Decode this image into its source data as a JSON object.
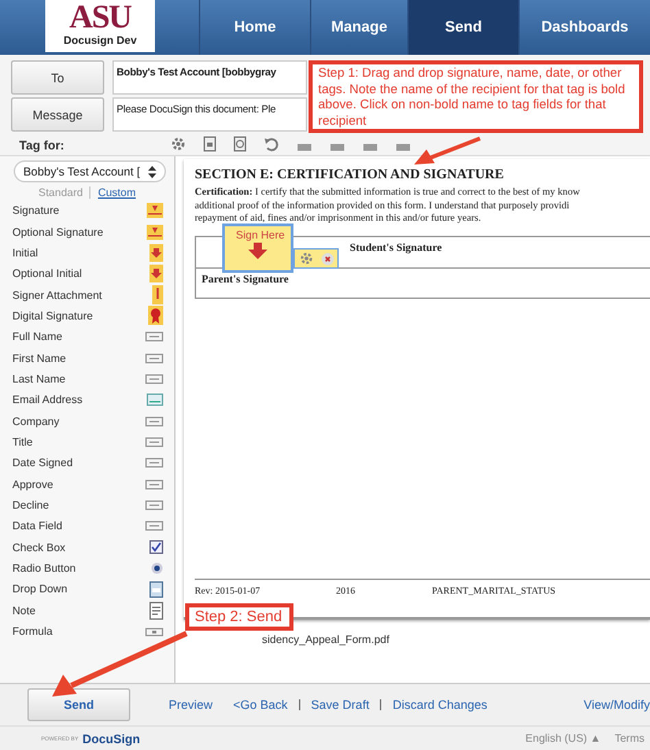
{
  "header": {
    "logo_text": "ASU",
    "logo_subtitle": "Docusign Dev",
    "nav": [
      {
        "label": "Home",
        "selected": false
      },
      {
        "label": "Manage",
        "selected": false
      },
      {
        "label": "Send",
        "selected": true
      },
      {
        "label": "Dashboards",
        "selected": false
      }
    ]
  },
  "recipient": {
    "to_button": "To",
    "to_value": "Bobby's Test Account [bobbygray",
    "message_button": "Message",
    "message_value": "Please DocuSign this document: Ple"
  },
  "tag_for": {
    "label": "Tag for:",
    "recipient": "Bobby's Test Account [",
    "tabs": [
      {
        "label": "Standard",
        "selected": true
      },
      {
        "label": "Custom",
        "selected": false
      }
    ]
  },
  "fields": [
    {
      "label": "Signature",
      "kind": "signature"
    },
    {
      "label": "Optional Signature",
      "kind": "signature"
    },
    {
      "label": "Initial",
      "kind": "initial"
    },
    {
      "label": "Optional Initial",
      "kind": "initial"
    },
    {
      "label": "Signer Attachment",
      "kind": "attachment"
    },
    {
      "label": "Digital Signature",
      "kind": "seal"
    },
    {
      "label": "Full Name",
      "kind": "text"
    },
    {
      "label": "First Name",
      "kind": "text"
    },
    {
      "label": "Last Name",
      "kind": "text"
    },
    {
      "label": "Email Address",
      "kind": "email"
    },
    {
      "label": "Company",
      "kind": "text"
    },
    {
      "label": "Title",
      "kind": "text"
    },
    {
      "label": "Date Signed",
      "kind": "text"
    },
    {
      "label": "Approve",
      "kind": "text"
    },
    {
      "label": "Decline",
      "kind": "text"
    },
    {
      "label": "Data Field",
      "kind": "text"
    },
    {
      "label": "Check Box",
      "kind": "checkbox"
    },
    {
      "label": "Radio Button",
      "kind": "radio"
    },
    {
      "label": "Drop Down",
      "kind": "dropdown"
    },
    {
      "label": "Note",
      "kind": "note"
    },
    {
      "label": "Formula",
      "kind": "formula"
    }
  ],
  "document": {
    "heading": "SECTION E: CERTIFICATION AND SIGNATURE",
    "lead": "Certification:",
    "lines": [
      "I certify that the submitted information is true and correct to the best of my know",
      "additional proof of the information provided on this form. I understand that purposely providi",
      "repayment of aid, fines and/or imprisonment in this and/or future years."
    ],
    "signature_rows": [
      "Student's Signature",
      "Parent's Signature"
    ],
    "footer": [
      "Rev: 2015-01-07",
      "2016",
      "PARENT_MARITAL_STATUS"
    ],
    "filename": "sidency_Appeal_Form.pdf"
  },
  "sign_tag": {
    "label": "Sign Here"
  },
  "callouts": [
    "Step 1: Drag and drop signature, name, date, or other tags.  Note the name of the recipient for that tag is bold above.  Click on non-bold name to tag fields for that recipient",
    "Step 2: Send"
  ],
  "actions": {
    "send": "Send",
    "links": [
      "Preview",
      "<Go Back",
      "Save Draft",
      "Discard Changes",
      "View/Modify"
    ]
  },
  "footer": {
    "powered": "POWERED BY",
    "brand": "DocuSign",
    "language": "English (US) ▲",
    "terms": "Terms"
  }
}
